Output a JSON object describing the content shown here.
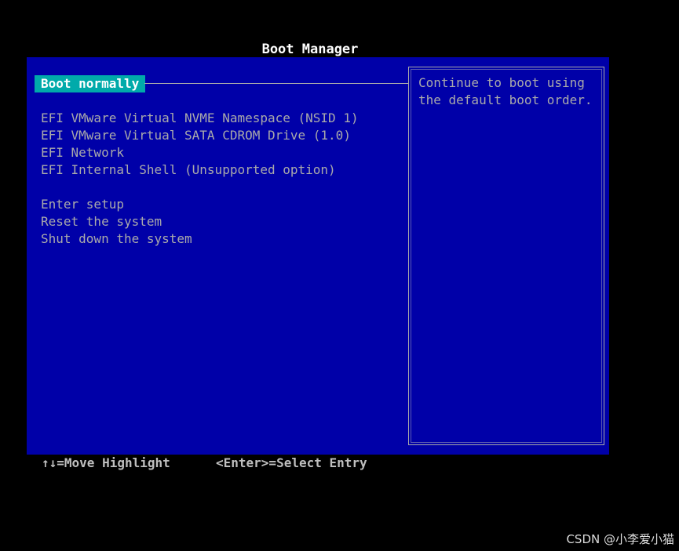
{
  "title": "Boot Manager",
  "menu": {
    "selected": "Boot normally",
    "boot_options": [
      "EFI VMware Virtual NVME Namespace (NSID 1)",
      "EFI VMware Virtual SATA CDROM Drive (1.0)",
      "EFI Network",
      "EFI Internal Shell (Unsupported option)"
    ],
    "system_options": [
      "Enter setup",
      "Reset the system",
      "Shut down the system"
    ]
  },
  "help": {
    "text": "Continue to boot using\nthe default boot order."
  },
  "footer": {
    "move_hint": "↑↓=Move Highlight",
    "select_hint": "<Enter>=Select Entry"
  },
  "watermark": "CSDN @小李爱小猫",
  "colors": {
    "background": "#000000",
    "panel": "#0000a8",
    "highlight": "#00aaaa",
    "text": "#aaaaaa",
    "selected_text": "#ffffff"
  }
}
